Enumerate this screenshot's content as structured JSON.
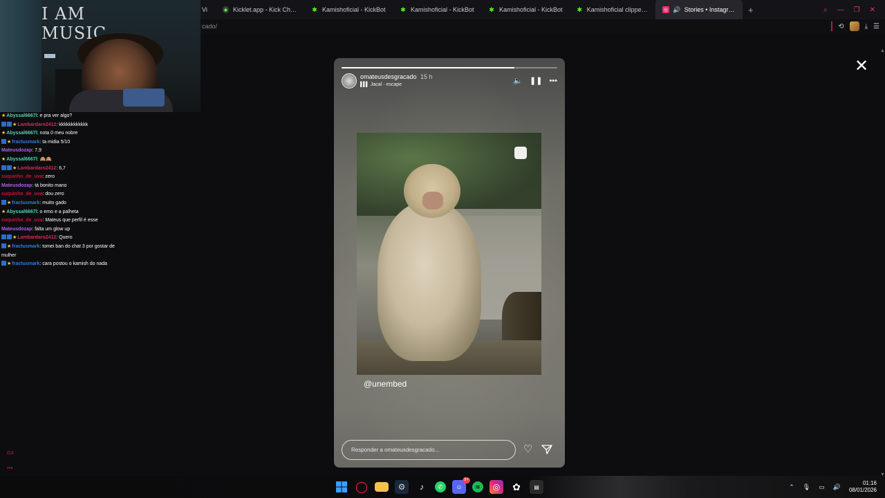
{
  "browser": {
    "tabs": [
      {
        "label": "Vi",
        "icon": "partial-tab-icon",
        "active": false
      },
      {
        "label": "Kicklet.app - Kick Chatbot",
        "icon": "kicklet-icon",
        "active": false
      },
      {
        "label": "Kamishoficial - KickBot",
        "icon": "kickbot-icon",
        "active": false
      },
      {
        "label": "Kamishoficial - KickBot",
        "icon": "kickbot-icon",
        "active": false
      },
      {
        "label": "Kamishoficial - KickBot",
        "icon": "kickbot-icon",
        "active": false
      },
      {
        "label": "Kamishoficial clipped by h",
        "icon": "kickbot-icon",
        "active": false
      },
      {
        "label": "Stories • Instagram",
        "icon": "instagram-icon",
        "active": true
      }
    ],
    "new_tab": "+",
    "url": "cado/"
  },
  "webcam": {
    "poster_text": "I AM MUSIC"
  },
  "chat": {
    "messages": [
      {
        "badges": "star",
        "user": "Abyssal6667l",
        "color": "#53d1b3",
        "text": "e pra ver algo?"
      },
      {
        "badges": "sq-sq-star",
        "user": "Lambardaro2412",
        "color": "#d12b58",
        "text": "kkkkkkkkkkkk"
      },
      {
        "badges": "star",
        "user": "Abyssal6667l",
        "color": "#53d1b3",
        "text": "nota 0 meu nobre"
      },
      {
        "badges": "sq-star",
        "user": "fractusmark",
        "color": "#2f7de1",
        "text": "ta midia 5/10"
      },
      {
        "badges": "",
        "user": "Mateusdozap",
        "color": "#b05ef0",
        "text": "7,9"
      },
      {
        "badges": "star",
        "user": "Abyssal6667l",
        "color": "#53d1b3",
        "text": "🙈🙈"
      },
      {
        "badges": "sq-sq-star",
        "user": "Lambardaro2412",
        "color": "#d12b58",
        "text": "6,7"
      },
      {
        "badges": "",
        "user": "suquinho_de_uva",
        "color": "#d0103a",
        "text": "zero"
      },
      {
        "badges": "",
        "user": "Mateusdozap",
        "color": "#b05ef0",
        "text": "tá bonito mano"
      },
      {
        "badges": "",
        "user": "suquinho_de_uva",
        "color": "#d0103a",
        "text": "dou zero"
      },
      {
        "badges": "sq-star",
        "user": "fractusmark",
        "color": "#2f7de1",
        "text": "muito gado"
      },
      {
        "badges": "star",
        "user": "Abyssal6667l",
        "color": "#53d1b3",
        "text": "o emo e a palheta"
      },
      {
        "badges": "",
        "user": "suquinho_de_uva",
        "color": "#d0103a",
        "text": "Mateus que perfil é esse"
      },
      {
        "badges": "",
        "user": "Mateusdozap",
        "color": "#b05ef0",
        "text": "falta um glow up"
      },
      {
        "badges": "sq-sq-star",
        "user": "Lambardaro2412",
        "color": "#d12b58",
        "text": "Quero"
      },
      {
        "badges": "sq-star",
        "user": "fractusmark",
        "color": "#2f7de1",
        "text": "tomei ban do chat 3 por gostar de mulher"
      },
      {
        "badges": "sq-star",
        "user": "fractusmark",
        "color": "#2f7de1",
        "text": "cara postou o kamish do nada"
      }
    ],
    "gx_label": "GX",
    "gx_dots": "•••"
  },
  "story": {
    "username": "omateusdesgracado",
    "time": "15 h",
    "music": "Jacal · escape",
    "progress": 0.8,
    "mention": "@unembed",
    "reply_placeholder": "Responder a omateusdesgracado...",
    "close": "✕"
  },
  "taskbar": {
    "icons": [
      "windows-start-icon",
      "opera-gx-icon",
      "file-explorer-icon",
      "steam-icon",
      "tiktok-icon",
      "whatsapp-icon",
      "discord-icon",
      "spotify-icon",
      "instagram-icon",
      "chatgpt-icon",
      "streamlabs-icon"
    ],
    "discord_badge": "9+",
    "time": "01:16",
    "date": "08/01/2026"
  },
  "colors": {
    "accent": "#c8104a",
    "background": "#0d0d0f"
  }
}
